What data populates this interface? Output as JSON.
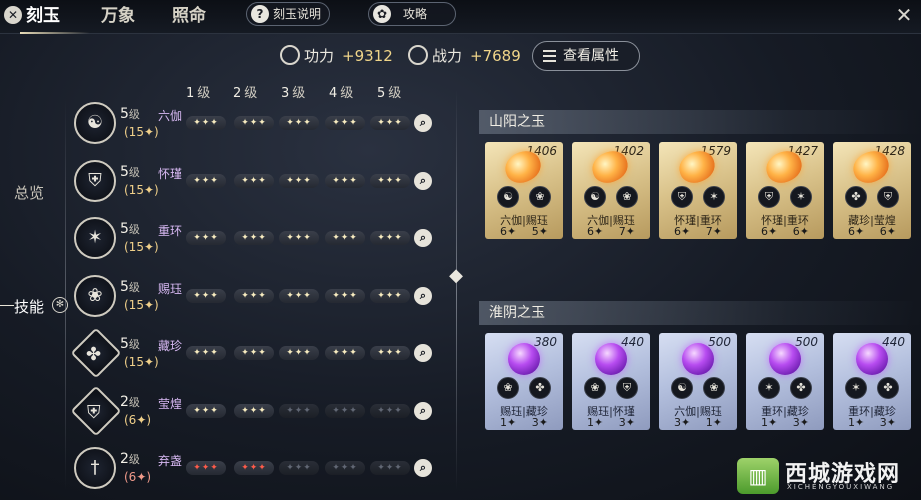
{
  "topbar": {
    "close_glyph": "✕",
    "tabs": [
      {
        "label": "刻玉"
      },
      {
        "label": "万象"
      },
      {
        "label": "照命"
      }
    ],
    "help": {
      "icon": "question-icon",
      "glyph": "?",
      "label": "刻玉说明"
    },
    "guide": {
      "icon": "guide-icon",
      "glyph": "✿",
      "label": "攻略"
    },
    "window_close_glyph": "✕"
  },
  "stats": {
    "power": {
      "icon": "power-icon",
      "label": "功力",
      "value": "+9312"
    },
    "combat": {
      "icon": "combat-icon",
      "label": "战力",
      "value": "+7689"
    },
    "view_attr_label": "查看属性"
  },
  "sidebar": {
    "tabs": [
      {
        "label": "总览"
      },
      {
        "label": "技能"
      }
    ],
    "gem_glyph": "✻"
  },
  "level_headers": [
    {
      "num": "1",
      "unit": "级"
    },
    {
      "num": "2",
      "unit": "级"
    },
    {
      "num": "3",
      "unit": "级"
    },
    {
      "num": "4",
      "unit": "级"
    },
    {
      "num": "5",
      "unit": "级"
    }
  ],
  "skills": [
    {
      "level": "5",
      "level_unit": "级",
      "name": "六伽",
      "sub": "(15✦)",
      "icon": "swirl-icon",
      "glyph": "☯",
      "filled": 5,
      "color": "gold"
    },
    {
      "level": "5",
      "level_unit": "级",
      "name": "怀瑾",
      "sub": "(15✦)",
      "icon": "shield-icon",
      "glyph": "⛨",
      "filled": 5,
      "color": "gold"
    },
    {
      "level": "5",
      "level_unit": "级",
      "name": "重环",
      "sub": "(15✦)",
      "icon": "blades-icon",
      "glyph": "✶",
      "filled": 5,
      "color": "gold"
    },
    {
      "level": "5",
      "level_unit": "级",
      "name": "赐珏",
      "sub": "(15✦)",
      "icon": "lotus-icon",
      "glyph": "❀",
      "filled": 5,
      "color": "gold"
    },
    {
      "level": "5",
      "level_unit": "级",
      "name": "藏珍",
      "sub": "(15✦)",
      "icon": "phoenix-icon",
      "glyph": "✤",
      "filled": 5,
      "color": "gold"
    },
    {
      "level": "2",
      "level_unit": "级",
      "name": "莹煌",
      "sub": "(6✦)",
      "icon": "crest-icon",
      "glyph": "⛨",
      "filled": 2,
      "color": "gold"
    },
    {
      "level": "2",
      "level_unit": "级",
      "name": "弃盏",
      "sub": "(6✦)",
      "icon": "sword-icon",
      "glyph": "†",
      "filled": 2,
      "color": "red"
    }
  ],
  "sections": {
    "yang": {
      "title": "山阳之玉"
    },
    "yin": {
      "title": "淮阴之玉"
    }
  },
  "yang_cards": [
    {
      "score": "1406",
      "names": "六伽|赐珏",
      "v1": "6✦",
      "v2": "5✦",
      "sk1": "☯",
      "sk2": "❀"
    },
    {
      "score": "1402",
      "names": "六伽|赐珏",
      "v1": "6✦",
      "v2": "7✦",
      "sk1": "☯",
      "sk2": "❀"
    },
    {
      "score": "1579",
      "names": "怀瑾|重环",
      "v1": "6✦",
      "v2": "7✦",
      "sk1": "⛨",
      "sk2": "✶"
    },
    {
      "score": "1427",
      "names": "怀瑾|重环",
      "v1": "6✦",
      "v2": "6✦",
      "sk1": "⛨",
      "sk2": "✶"
    },
    {
      "score": "1428",
      "names": "藏珍|莹煌",
      "v1": "6✦",
      "v2": "6✦",
      "sk1": "✤",
      "sk2": "⛨"
    }
  ],
  "yin_cards": [
    {
      "score": "380",
      "names": "赐珏|藏珍",
      "v1": "1✦",
      "v2": "3✦",
      "sk1": "❀",
      "sk2": "✤"
    },
    {
      "score": "440",
      "names": "赐珏|怀瑾",
      "v1": "1✦",
      "v2": "3✦",
      "sk1": "❀",
      "sk2": "⛨"
    },
    {
      "score": "500",
      "names": "六伽|赐珏",
      "v1": "3✦",
      "v2": "1✦",
      "sk1": "☯",
      "sk2": "❀"
    },
    {
      "score": "500",
      "names": "重环|藏珍",
      "v1": "1✦",
      "v2": "3✦",
      "sk1": "✶",
      "sk2": "✤"
    },
    {
      "score": "440",
      "names": "重环|藏珍",
      "v1": "1✦",
      "v2": "3✦",
      "sk1": "✶",
      "sk2": "✤"
    }
  ],
  "watermark": {
    "logo": "▥",
    "text": "西城游戏网",
    "sub": "XICHENGYOUXIWANG"
  }
}
